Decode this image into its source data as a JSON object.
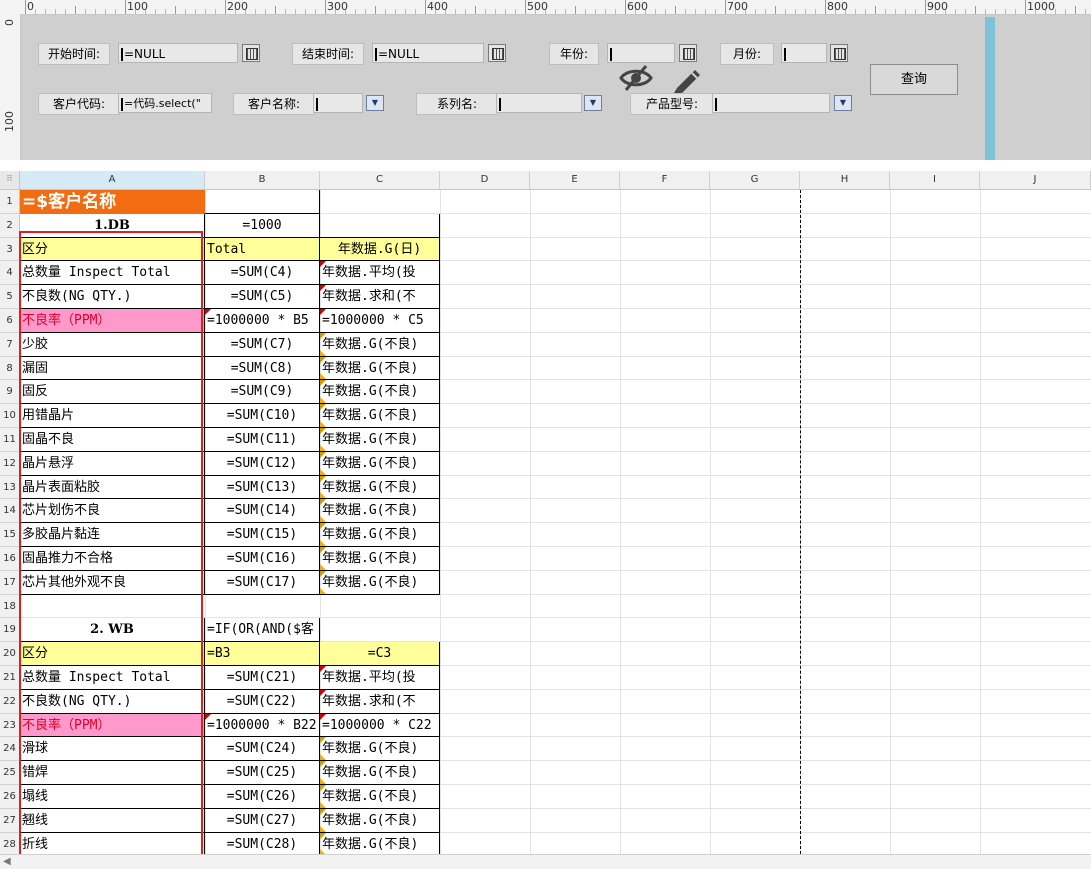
{
  "ruler": {
    "labels": [
      "0",
      "100",
      "200",
      "300",
      "400",
      "500",
      "600",
      "700",
      "800",
      "900",
      "1000"
    ],
    "v_labels": [
      "0",
      "100"
    ]
  },
  "params": {
    "start_time_label": "开始时间:",
    "start_time_value": "=NULL",
    "end_time_label": "结束时间:",
    "end_time_value": "=NULL",
    "year_label": "年份:",
    "month_label": "月份:",
    "customer_code_label": "客户代码:",
    "customer_code_value": "=代码.select(\"",
    "customer_name_label": "客户名称:",
    "series_label": "系列名:",
    "model_label": "产品型号:",
    "query_label": "查询"
  },
  "columns": [
    "A",
    "B",
    "C",
    "D",
    "E",
    "F",
    "G",
    "H",
    "I",
    "J"
  ],
  "rows": [
    {
      "n": "1",
      "a": "=$客户名称",
      "b": "",
      "c": ""
    },
    {
      "n": "2",
      "a": "1.DB",
      "b": "=1000",
      "c": ""
    },
    {
      "n": "3",
      "a": "区分",
      "b": "Total",
      "c": "年数据.G(日)"
    },
    {
      "n": "4",
      "a": "总数量 Inspect Total",
      "b": "=SUM(C4)",
      "c": "年数据.平均(投"
    },
    {
      "n": "5",
      "a": "不良数(NG QTY.)",
      "b": "=SUM(C5)",
      "c": "年数据.求和(不"
    },
    {
      "n": "6",
      "a": "不良率（PPM）",
      "b": "=1000000 * B5",
      "c": "=1000000 * C5"
    },
    {
      "n": "7",
      "a": "少胶",
      "b": "=SUM(C7)",
      "c": "年数据.G(不良)"
    },
    {
      "n": "8",
      "a": "漏固",
      "b": "=SUM(C8)",
      "c": "年数据.G(不良)"
    },
    {
      "n": "9",
      "a": "固反",
      "b": "=SUM(C9)",
      "c": "年数据.G(不良)"
    },
    {
      "n": "10",
      "a": "用错晶片",
      "b": "=SUM(C10)",
      "c": "年数据.G(不良)"
    },
    {
      "n": "11",
      "a": "固晶不良",
      "b": "=SUM(C11)",
      "c": "年数据.G(不良)"
    },
    {
      "n": "12",
      "a": "晶片悬浮",
      "b": "=SUM(C12)",
      "c": "年数据.G(不良)"
    },
    {
      "n": "13",
      "a": "晶片表面粘胶",
      "b": "=SUM(C13)",
      "c": "年数据.G(不良)"
    },
    {
      "n": "14",
      "a": "芯片划伤不良",
      "b": "=SUM(C14)",
      "c": "年数据.G(不良)"
    },
    {
      "n": "15",
      "a": "多胶晶片黏连",
      "b": "=SUM(C15)",
      "c": "年数据.G(不良)"
    },
    {
      "n": "16",
      "a": "固晶推力不合格",
      "b": "=SUM(C16)",
      "c": "年数据.G(不良)"
    },
    {
      "n": "17",
      "a": "芯片其他外观不良",
      "b": "=SUM(C17)",
      "c": "年数据.G(不良)"
    },
    {
      "n": "18",
      "a": "",
      "b": "",
      "c": ""
    },
    {
      "n": "19",
      "a": "2. WB",
      "b": "=IF(OR(AND($客",
      "c": ""
    },
    {
      "n": "20",
      "a": "区分",
      "b": "=B3",
      "c": "=C3"
    },
    {
      "n": "21",
      "a": "总数量 Inspect Total",
      "b": "=SUM(C21)",
      "c": "年数据.平均(投"
    },
    {
      "n": "22",
      "a": "不良数(NG QTY.)",
      "b": "=SUM(C22)",
      "c": "年数据.求和(不"
    },
    {
      "n": "23",
      "a": "不良率（PPM）",
      "b": "=1000000 * B22",
      "c": "=1000000 * C22"
    },
    {
      "n": "24",
      "a": "滑球",
      "b": "=SUM(C24)",
      "c": "年数据.G(不良)"
    },
    {
      "n": "25",
      "a": "错焊",
      "b": "=SUM(C25)",
      "c": "年数据.G(不良)"
    },
    {
      "n": "26",
      "a": "塌线",
      "b": "=SUM(C26)",
      "c": "年数据.G(不良)"
    },
    {
      "n": "27",
      "a": "翘线",
      "b": "=SUM(C27)",
      "c": "年数据.G(不良)"
    },
    {
      "n": "28",
      "a": "折线",
      "b": "=SUM(C28)",
      "c": "年数据.G(不良)"
    }
  ],
  "colors": {
    "title_bg": "#f26c12",
    "header_yellow": "#ffff99",
    "ppm_pink": "#ff99cc",
    "frame_red": "#e02020",
    "panel": "#cfcfcf"
  }
}
